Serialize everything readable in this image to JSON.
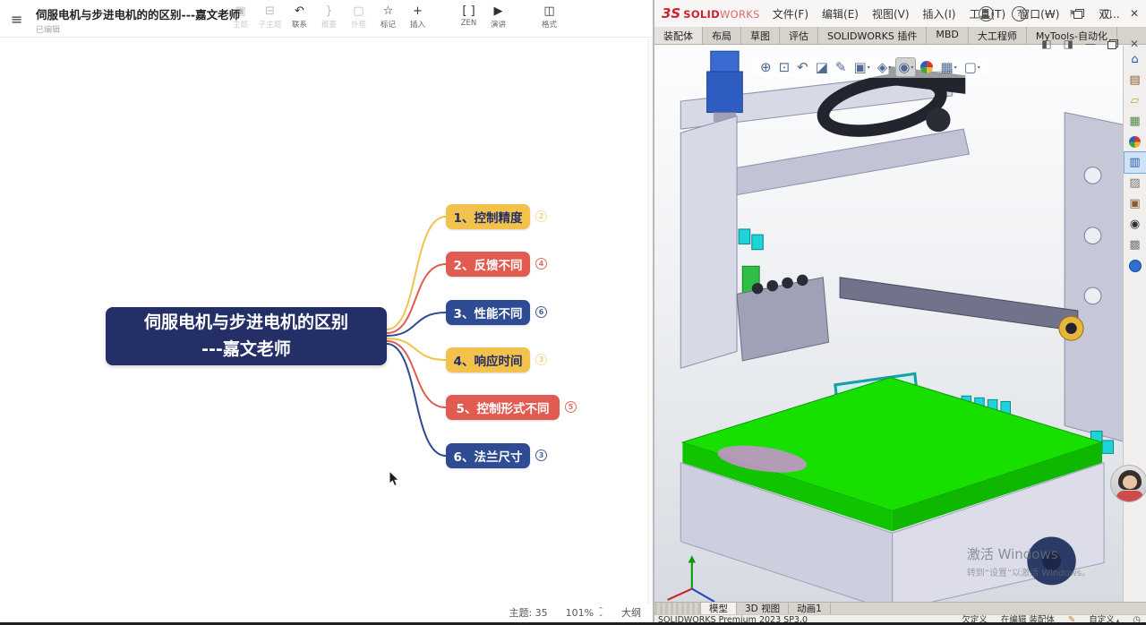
{
  "left_app": {
    "header": {
      "title": "伺服电机与步进电机的的区别---嘉文老师",
      "subtitle": "已编辑"
    },
    "toolbar": {
      "items": [
        {
          "label": "主题",
          "glyph": "▣"
        },
        {
          "label": "子主题",
          "glyph": "⊟"
        },
        {
          "label": "联系",
          "glyph": "↶"
        },
        {
          "label": "概要",
          "glyph": "}"
        },
        {
          "label": "外框",
          "glyph": "▢"
        },
        {
          "label": "标记",
          "glyph": "☆"
        },
        {
          "label": "插入",
          "glyph": "+"
        },
        {
          "label": "ZEN",
          "glyph": "[ ]"
        },
        {
          "label": "演讲",
          "glyph": "▶"
        },
        {
          "label": "格式",
          "glyph": "◫"
        }
      ]
    },
    "mindmap": {
      "central": {
        "line1": "伺服电机与步进电机的区别",
        "line2": "---嘉文老师",
        "bg": "#232f66",
        "text_color": "#ffffff"
      },
      "branches": [
        {
          "label": "1、控制精度",
          "badge": "2",
          "bg": "#f2c24d",
          "text_color": "#232f66"
        },
        {
          "label": "2、反馈不同",
          "badge": "4",
          "bg": "#e25b50",
          "text_color": "#ffffff"
        },
        {
          "label": "3、性能不同",
          "badge": "6",
          "bg": "#2e4b93",
          "text_color": "#ffffff"
        },
        {
          "label": "4、响应时间",
          "badge": "3",
          "bg": "#f2c24d",
          "text_color": "#232f66"
        },
        {
          "label": "5、控制形式不同",
          "badge": "5",
          "bg": "#e25b50",
          "text_color": "#ffffff"
        },
        {
          "label": "6、法兰尺寸",
          "badge": "3",
          "bg": "#2e4b93",
          "text_color": "#ffffff"
        }
      ]
    },
    "statusbar": {
      "topics": "主题: 35",
      "zoom": "101%",
      "outline": "大纲"
    }
  },
  "right_app": {
    "menubar": {
      "logo_mark": "3S",
      "logo_solid": "SOLID",
      "logo_works": "WORKS",
      "menus": [
        "文件(F)",
        "编辑(E)",
        "视图(V)",
        "插入(I)",
        "工具(T)",
        "窗口(W)"
      ],
      "pin_glyph": "⚑",
      "doc_short": "双...",
      "window_controls": {
        "minimize": "—",
        "maximize": "□",
        "close": "✕"
      }
    },
    "command_tabs": [
      "装配体",
      "布局",
      "草图",
      "评估",
      "SOLIDWORKS 插件",
      "MBD",
      "大工程师",
      "MyTools-自动化"
    ],
    "doc_pane_controls": {
      "pane_left": "◧",
      "pane_right": "◨",
      "minimize": "—",
      "close": "✕"
    },
    "headsup_icons": [
      {
        "name": "zoom-to-fit-icon",
        "glyph": "⊕"
      },
      {
        "name": "zoom-to-area-icon",
        "glyph": "⊡"
      },
      {
        "name": "previous-view-icon",
        "glyph": "↶"
      },
      {
        "name": "section-view-icon",
        "glyph": "◪"
      },
      {
        "name": "dynamic-annotation-icon",
        "glyph": "✎"
      },
      {
        "name": "view-orientation-icon",
        "glyph": "▣"
      },
      {
        "name": "display-style-icon",
        "glyph": "◈"
      },
      {
        "name": "hide-show-items-icon",
        "glyph": "◉"
      },
      {
        "name": "edit-appearance-icon",
        "glyph": ""
      },
      {
        "name": "apply-scene-icon",
        "glyph": "▦"
      },
      {
        "name": "view-settings-icon",
        "glyph": "▢"
      }
    ],
    "taskpane_icons": [
      {
        "name": "home-icon",
        "glyph": "⌂"
      },
      {
        "name": "design-library-icon",
        "glyph": "▤"
      },
      {
        "name": "file-explorer-icon",
        "glyph": "▱"
      },
      {
        "name": "view-palette-icon",
        "glyph": "▦"
      },
      {
        "name": "appearances-icon",
        "glyph": ""
      },
      {
        "name": "custom-properties-icon",
        "glyph": "▥"
      },
      {
        "name": "tools-icon",
        "glyph": "▨"
      },
      {
        "name": "parts-library-icon",
        "glyph": "▣"
      },
      {
        "name": "preview-icon",
        "glyph": "◉"
      },
      {
        "name": "templates-icon",
        "glyph": "▩"
      },
      {
        "name": "3dexperience-icon",
        "glyph": ""
      }
    ],
    "doc_tabs": [
      "模型",
      "3D 视图",
      "动画1"
    ],
    "statusbar": {
      "product": "SOLIDWORKS Premium 2023 SP3.0",
      "constraint": "欠定义",
      "editing": "在编辑 装配体",
      "pencil_glyph": "✎",
      "customize": "自定义",
      "clock_glyph": "◷"
    },
    "watermark": {
      "line1": "激活 Windows",
      "line2": "转到“设置”以激活 Windows。"
    }
  }
}
